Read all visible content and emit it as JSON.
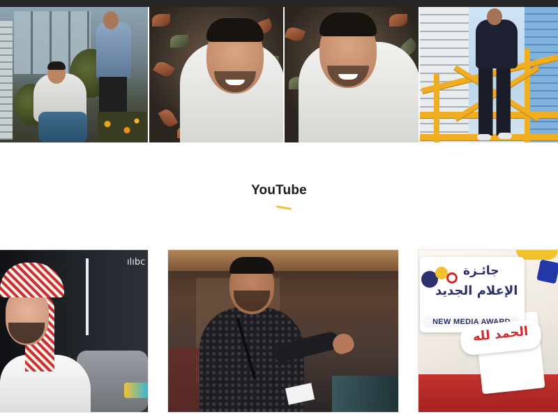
{
  "header": {
    "bar_color": "#262626"
  },
  "gallery": {
    "photos": [
      {
        "description_icon": "photo-image",
        "alt": ""
      },
      {
        "description_icon": "photo-image",
        "alt": ""
      },
      {
        "description_icon": "photo-image",
        "alt": ""
      },
      {
        "description_icon": "photo-image",
        "alt": ""
      }
    ]
  },
  "section": {
    "title": "YouTube",
    "accent_color": "#f2c12e"
  },
  "videos": {
    "cards": [
      {
        "logo_text": "ılıbc"
      },
      {},
      {
        "sign_line1": "جائـزة",
        "sign_line2": "الإعلام الجديد",
        "sign_line3": "NEW MEDIA AWARD",
        "sticker_text": "الحمد لله"
      }
    ]
  }
}
